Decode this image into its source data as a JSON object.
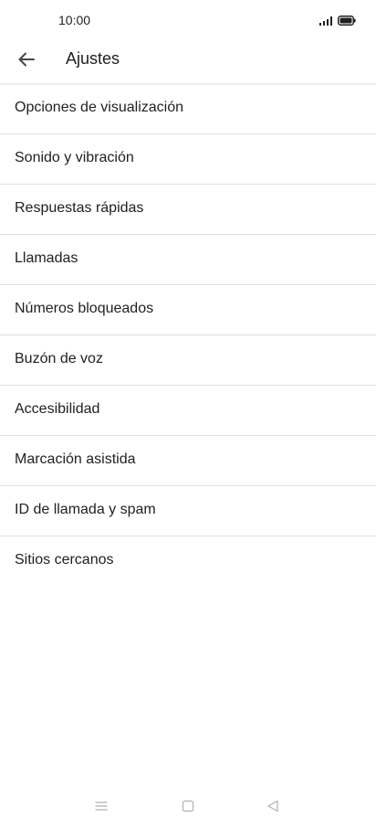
{
  "status_bar": {
    "time": "10:00"
  },
  "app_bar": {
    "back_icon": "arrow-back-icon",
    "title": "Ajustes"
  },
  "settings": {
    "items": [
      {
        "label": "Opciones de visualización"
      },
      {
        "label": "Sonido y vibración"
      },
      {
        "label": "Respuestas rápidas"
      },
      {
        "label": "Llamadas"
      },
      {
        "label": "Números bloqueados"
      },
      {
        "label": "Buzón de voz"
      },
      {
        "label": "Accesibilidad"
      },
      {
        "label": "Marcación asistida"
      },
      {
        "label": "ID de llamada y spam"
      },
      {
        "label": "Sitios cercanos"
      }
    ]
  },
  "nav_bar": {
    "icons": [
      "menu-icon",
      "home-icon",
      "back-triangle-icon"
    ]
  },
  "colors": {
    "text": "#202124",
    "divider": "#e0e0e0",
    "background": "#ffffff",
    "nav_icon": "#b0b0b0"
  }
}
